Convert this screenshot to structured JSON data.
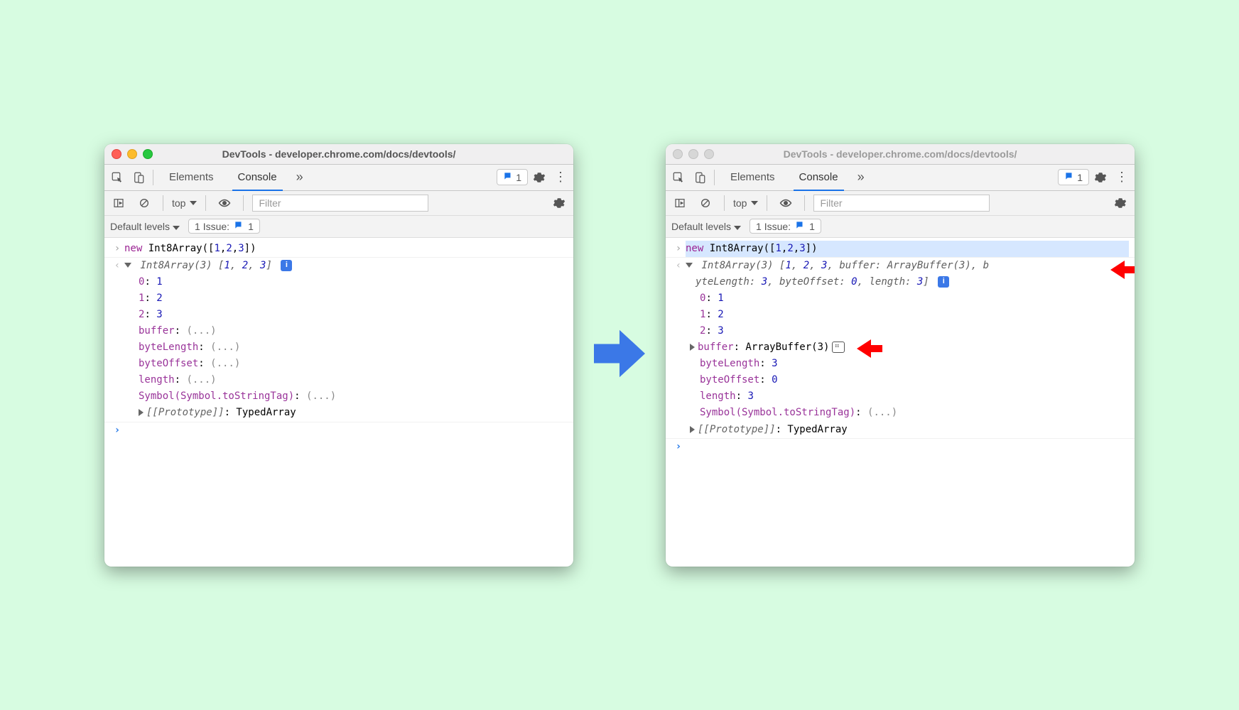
{
  "window_title": "DevTools - developer.chrome.com/docs/devtools/",
  "tabs": {
    "elements": "Elements",
    "console": "Console"
  },
  "issues_count": "1",
  "context_label": "top",
  "filter_placeholder": "Filter",
  "default_levels": "Default levels",
  "issue_label": "1 Issue:",
  "issue_badge_count": "1",
  "input_expr": {
    "kw": "new",
    "call": " Int8Array(",
    "bracket_open": "[",
    "n1": "1",
    "n2": "2",
    "n3": "3",
    "bracket_close": "]",
    "paren_close": ")"
  },
  "left": {
    "header": "Int8Array(3) ",
    "subheader_open": "[",
    "h1": "1",
    "h2": "2",
    "h3": "3",
    "subheader_close": "]",
    "entries": [
      {
        "k": "0",
        "v": "1"
      },
      {
        "k": "1",
        "v": "2"
      },
      {
        "k": "2",
        "v": "3"
      },
      {
        "k": "buffer",
        "v": "(...)"
      },
      {
        "k": "byteLength",
        "v": "(...)"
      },
      {
        "k": "byteOffset",
        "v": "(...)"
      },
      {
        "k": "length",
        "v": "(...)"
      },
      {
        "k": "Symbol(Symbol.toStringTag)",
        "v": "(...)"
      }
    ],
    "proto_k": "[[Prototype]]",
    "proto_v": "TypedArray"
  },
  "right": {
    "header_line1": "Int8Array(3) [1, 2, 3, buffer: ArrayBuffer(3), b",
    "header_line2": "yteLength: 3, byteOffset: 0, length: 3]",
    "entries_idx": [
      {
        "k": "0",
        "v": "1"
      },
      {
        "k": "1",
        "v": "2"
      },
      {
        "k": "2",
        "v": "3"
      }
    ],
    "buffer_k": "buffer",
    "buffer_v": "ArrayBuffer(3)",
    "entries_props": [
      {
        "k": "byteLength",
        "v": "3"
      },
      {
        "k": "byteOffset",
        "v": "0"
      },
      {
        "k": "length",
        "v": "3"
      },
      {
        "k": "Symbol(Symbol.toStringTag)",
        "v": "(...)"
      }
    ],
    "proto_k": "[[Prototype]]",
    "proto_v": "TypedArray"
  }
}
